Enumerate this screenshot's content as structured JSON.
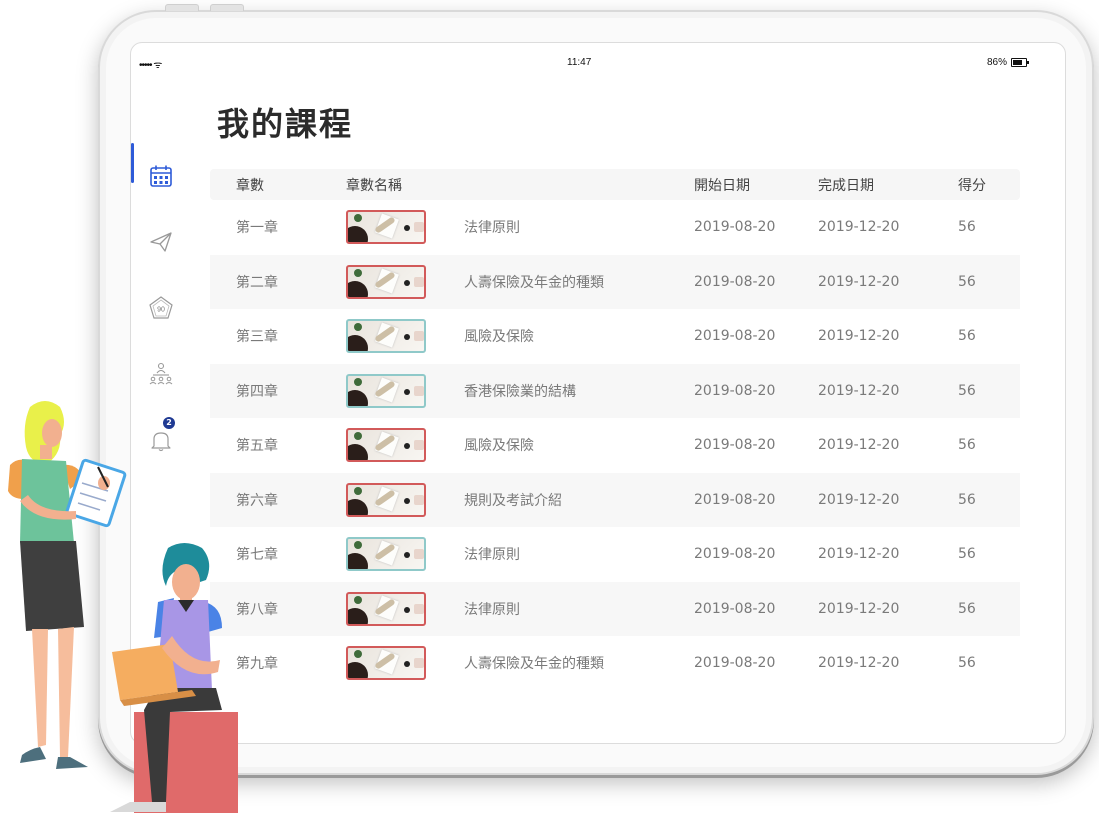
{
  "status_bar": {
    "signal": "••••• ᯤ",
    "time": "11:47",
    "battery": "86%"
  },
  "page_title": "我的課程",
  "sidebar": {
    "items": [
      {
        "icon": "calendar-icon",
        "active": true
      },
      {
        "icon": "paper-plane-icon",
        "active": false
      },
      {
        "icon": "score-pentagon-icon",
        "label": "90",
        "active": false
      },
      {
        "icon": "org-chart-icon",
        "active": false
      },
      {
        "icon": "bell-icon",
        "badge": "2",
        "active": false
      }
    ]
  },
  "table": {
    "headers": {
      "chapter": "章數",
      "name": "章數名稱",
      "start": "開始日期",
      "end": "完成日期",
      "score": "得分"
    },
    "rows": [
      {
        "chapter": "第一章",
        "name": "法律原則",
        "start": "2019-08-20",
        "end": "2019-12-20",
        "score": "56",
        "thumb": "red"
      },
      {
        "chapter": "第二章",
        "name": "人壽保險及年金的種類",
        "start": "2019-08-20",
        "end": "2019-12-20",
        "score": "56",
        "thumb": "red"
      },
      {
        "chapter": "第三章",
        "name": "風險及保險",
        "start": "2019-08-20",
        "end": "2019-12-20",
        "score": "56",
        "thumb": "teal"
      },
      {
        "chapter": "第四章",
        "name": "香港保險業的結構",
        "start": "2019-08-20",
        "end": "2019-12-20",
        "score": "56",
        "thumb": "teal"
      },
      {
        "chapter": "第五章",
        "name": "風險及保險",
        "start": "2019-08-20",
        "end": "2019-12-20",
        "score": "56",
        "thumb": "red"
      },
      {
        "chapter": "第六章",
        "name": "規則及考試介紹",
        "start": "2019-08-20",
        "end": "2019-12-20",
        "score": "56",
        "thumb": "red"
      },
      {
        "chapter": "第七章",
        "name": "法律原則",
        "start": "2019-08-20",
        "end": "2019-12-20",
        "score": "56",
        "thumb": "teal"
      },
      {
        "chapter": "第八章",
        "name": "法律原則",
        "start": "2019-08-20",
        "end": "2019-12-20",
        "score": "56",
        "thumb": "red"
      },
      {
        "chapter": "第九章",
        "name": "人壽保險及年金的種類",
        "start": "2019-08-20",
        "end": "2019-12-20",
        "score": "56",
        "thumb": "red"
      }
    ]
  },
  "colors": {
    "accent": "#2e5bd8",
    "thumb_red": "#d25a5a",
    "thumb_teal": "#8fc9c9",
    "badge": "#1f3a93"
  }
}
